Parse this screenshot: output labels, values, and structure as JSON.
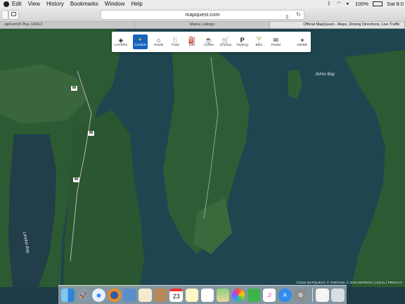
{
  "menubar": {
    "items": [
      "Edit",
      "View",
      "History",
      "Bookmarks",
      "Window",
      "Help"
    ],
    "battery": "100%",
    "clock": "Sat 8:0"
  },
  "browser": {
    "address": "mapquest.com",
    "tabs": [
      "zipForm® Plus 1604.2",
      "Maine Listings",
      "Official MapQuest - Maps, Driving Directions, Live Traffic"
    ]
  },
  "categories": [
    {
      "label": "LAYERS",
      "icon": "layers-icon",
      "glyph": "◈"
    },
    {
      "label": "Comfort",
      "icon": "comfort-inn-logo",
      "glyph": "★"
    },
    {
      "label": "Hotels",
      "icon": "hotel-icon",
      "glyph": "⌂"
    },
    {
      "label": "Food",
      "icon": "food-icon",
      "glyph": "🍴"
    },
    {
      "label": "Gas",
      "icon": "gas-icon",
      "glyph": "⛽"
    },
    {
      "label": "Coffee",
      "icon": "coffee-icon",
      "glyph": "☕"
    },
    {
      "label": "Grocery",
      "icon": "grocery-icon",
      "glyph": "🛒"
    },
    {
      "label": "Parking",
      "icon": "parking-icon",
      "glyph": "P"
    },
    {
      "label": "Bars",
      "icon": "bar-icon",
      "glyph": "🍸"
    },
    {
      "label": "Postal",
      "icon": "postal-icon",
      "glyph": "✉"
    },
    {
      "label": "MORE",
      "icon": "plus-icon",
      "glyph": "+"
    }
  ],
  "map": {
    "labels": {
      "johns_bay": "Johns Bay",
      "linekin_bay": "Linekin Bay"
    },
    "route_shields": [
      "96",
      "96",
      "96"
    ],
    "attribution": "©2016 MAPQUEST, © TOMTOM, © 2015 MAPBOX | LEGAL | PRIVACY"
  },
  "dock": {
    "calendar_day": "23",
    "apps": [
      "finder-icon",
      "launchpad-icon",
      "safari-icon",
      "firefox-icon",
      "preview-icon",
      "textedit-icon",
      "contacts-icon",
      "calendar-icon",
      "notes-icon",
      "reminders-icon",
      "maps-icon",
      "photos-icon",
      "facetime-icon",
      "itunes-icon",
      "app-store-icon",
      "system-preferences-icon",
      "document-icon",
      "trash-icon"
    ]
  },
  "colors": {
    "water": "#1f4550",
    "land": "#2c5a33",
    "comfort_brand": "#1565c0"
  }
}
